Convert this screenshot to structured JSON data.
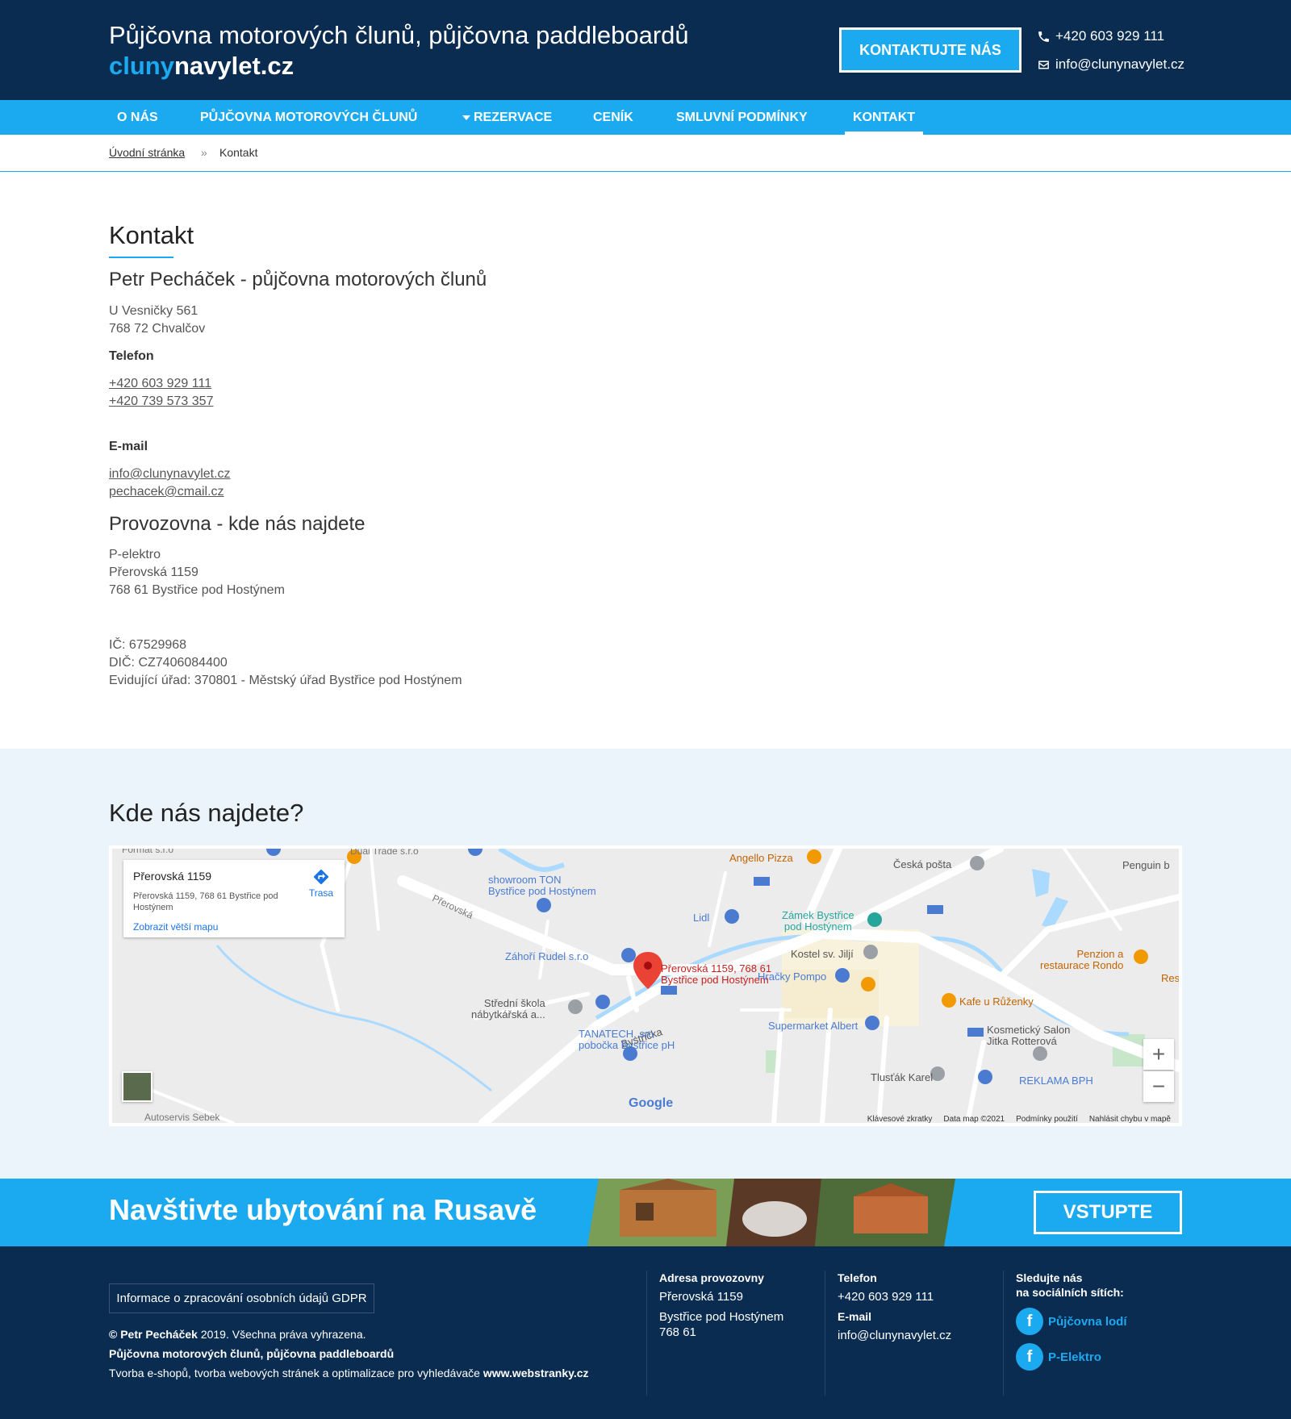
{
  "header": {
    "title": "Půjčovna motorových člunů, půjčovna paddleboardů",
    "logo_part1": "cluny",
    "logo_part2": "navylet.cz",
    "contact_button": "KONTAKTUJTE NÁS",
    "phone": "+420 603 929 111",
    "email": "info@clunynavylet.cz"
  },
  "nav": {
    "items": [
      {
        "label": "O NÁS"
      },
      {
        "label": "PŮJČOVNA MOTOROVÝCH ČLUNŮ"
      },
      {
        "label": "REZERVACE"
      },
      {
        "label": "CENÍK"
      },
      {
        "label": "SMLUVNÍ PODMÍNKY"
      },
      {
        "label": "KONTAKT"
      }
    ]
  },
  "breadcrumb": {
    "home": "Úvodní stránka",
    "separator": "»",
    "current": "Kontakt"
  },
  "content": {
    "title": "Kontakt",
    "owner_heading": "Petr Pecháček - půjčovna motorových člunů",
    "owner_address_line1": "U Vesničky 561",
    "owner_address_line2": "768 72 Chvalčov",
    "phone_label": "Telefon",
    "phone1": "+420 603 929 111",
    "phone2": "+420 739 573 357",
    "email_label": "E-mail",
    "email1": "info@clunynavylet.cz",
    "email2": "pechacek@cmail.cz",
    "shop_heading": "Provozovna - kde nás najdete",
    "shop_line1": "P-elektro",
    "shop_line2": "Přerovská 1159",
    "shop_line3": "768 61 Bystřice pod Hostýnem",
    "ic": "IČ: 67529968",
    "dic": "DIČ: CZ7406084400",
    "office": "Evidující úřad: 370801 - Městský úřad Bystřice pod Hostýnem"
  },
  "map": {
    "title": "Kde nás najdete?",
    "card_title": "Přerovská 1159",
    "card_address": "Přerovská 1159, 768 61 Bystřice pod Hostýnem",
    "card_link": "Zobrazit větší mapu",
    "card_directions": "Trasa",
    "pin_label_line1": "Přerovská 1159, 768 61",
    "pin_label_line2": "Bystřice pod Hostýnem",
    "zoom_in": "+",
    "zoom_out": "−",
    "google": "Google",
    "footer_shortcuts": "Klávesové zkratky",
    "footer_data": "Data map ©2021",
    "footer_terms": "Podmínky použití",
    "footer_report": "Nahlásit chybu v mapě",
    "pois": {
      "angello": "Angello Pizza",
      "posta": "Česká pošta",
      "penguin": "Penguin b",
      "showroom1": "showroom TON",
      "showroom2": "Bystřice pod Hostýnem",
      "lidl": "Lidl",
      "zamek1": "Zámek Bystřice",
      "zamek2": "pod Hostýnem",
      "zahori": "Záhoří Rudel s.r.o",
      "kostel": "Kostel sv. Jiljí",
      "penzion1": "Penzion a",
      "penzion2": "restaurace Rondo",
      "res": "Res",
      "hracky": "Hračky Pompo",
      "skola1": "Střední škola",
      "skola2": "nábytkářská a...",
      "kafe": "Kafe u Růženky",
      "tanatech1": "TANATECH, sro",
      "tanatech2": "pobočka Bystřice pH",
      "albert": "Supermarket Albert",
      "kosm1": "Kosmetický Salon",
      "kosm2": "Jitka Rotterová",
      "tlustak": "Tlusťák Karel",
      "reklama": "REKLAMA BPH",
      "bystricka": "Bystřička",
      "prerovska": "Přerovská",
      "duha": "Duai Trade s.r.o",
      "formal": "Format s.r.o",
      "autoservis": "Autoservis Sebek"
    }
  },
  "banner": {
    "text": "Navštivte ubytování na Rusavě",
    "button": "VSTUPTE"
  },
  "footer": {
    "gdpr": "Informace o zpracování osobních údajů GDPR",
    "copyright_name": "© Petr Pecháček",
    "copyright_rest": " 2019. Všechna práva vyhrazena.",
    "company": "Půjčovna motorových člunů, půjčovna paddleboardů",
    "creator_text": "Tvorba e-shopů, tvorba webových stránek a optimalizace pro vyhledávače ",
    "creator_link": "www.webstranky.cz",
    "address_label": "Adresa provozovny",
    "address_line1": "Přerovská 1159",
    "address_line2": "Bystřice pod Hostýnem",
    "address_line3": "768 61",
    "phone_label": "Telefon",
    "phone": "+420 603 929 111",
    "email_label": "E-mail",
    "email": "info@clunynavylet.cz",
    "social_label_line1": "Sledujte nás",
    "social_label_line2": "na sociálních sítích:",
    "social1": "Půjčovna lodí",
    "social2": "P-Elektro",
    "fb_glyph": "f"
  }
}
